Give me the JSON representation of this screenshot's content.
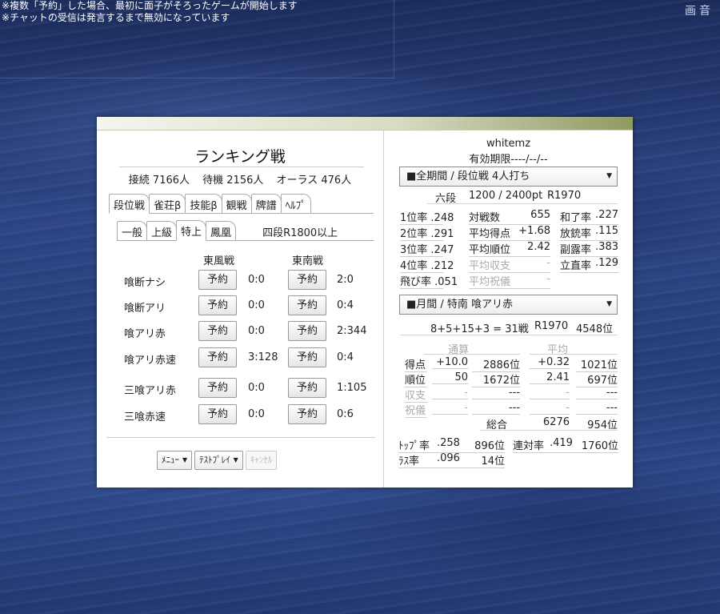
{
  "notice": {
    "line1": "※複数「予約」した場合、最初に面子がそろったゲームが開始します",
    "line2": "※チャットの受信は発言するまで無効になっています"
  },
  "corner_icons": [
    "画",
    "音"
  ],
  "lobby": {
    "title": "ランキング戦",
    "stats": {
      "connected": "接続 7166人",
      "waiting": "待機 2156人",
      "oras": "オーラス 476人"
    },
    "tabs": [
      "段位戦",
      "雀荘β",
      "技能β",
      "観戦",
      "牌譜",
      "ﾍﾙﾌﾟ"
    ],
    "subtabs": [
      "一般",
      "上級",
      "特上",
      "鳳凰"
    ],
    "condition": "四段R1800以上",
    "col_east": "東風戦",
    "col_south": "東南戦",
    "reserve_label": "予約",
    "rows": [
      {
        "name": "喰断ナシ",
        "east": "0:0",
        "south": "2:0"
      },
      {
        "name": "喰断アリ",
        "east": "0:0",
        "south": "0:4"
      },
      {
        "name": "喰アリ赤",
        "east": "0:0",
        "south": "2:344"
      },
      {
        "name": "喰アリ赤速",
        "east": "3:128",
        "south": "0:4"
      },
      {
        "name": "三喰アリ赤",
        "east": "0:0",
        "south": "1:105"
      },
      {
        "name": "三喰赤速",
        "east": "0:0",
        "south": "0:6"
      }
    ],
    "menu": "ﾒﾆｭｰ",
    "testplay": "ﾃｽﾄﾌﾟﾚｲ",
    "cancel": "ｷｬﾝｾﾙ"
  },
  "profile": {
    "username": "whitemz",
    "expiry": "有効期限----/--/--",
    "period_select": "■全期間 / 段位戦 4人打ち",
    "rank": "六段",
    "points": "1200 / 2400pt",
    "rate": "R1970",
    "stats": {
      "r1": [
        "1位率",
        ".248"
      ],
      "r2": [
        "2位率",
        ".291"
      ],
      "r3": [
        "3位率",
        ".247"
      ],
      "r4": [
        "4位率",
        ".212"
      ],
      "tobi": [
        "飛び率",
        ".051"
      ],
      "games": [
        "対戦数",
        "655"
      ],
      "avg_score": [
        "平均得点",
        "+1.68"
      ],
      "avg_rank": [
        "平均順位",
        "2.42"
      ],
      "avg_income": [
        "平均収支",
        "-"
      ],
      "avg_bonus": [
        "平均祝儀",
        "-"
      ],
      "win": [
        "和了率",
        ".227"
      ],
      "deal_in": [
        "放銃率",
        ".115"
      ],
      "call": [
        "副露率",
        ".383"
      ],
      "riichi": [
        "立直率",
        ".129"
      ]
    },
    "month_select": "■月間 / 特南 喰アリ赤",
    "month_games": "8+5+15+3 = 31戦",
    "month_rate": "R1970",
    "month_rank": "4548位",
    "col_total": "通算",
    "col_avg": "平均",
    "table": [
      {
        "label": "得点",
        "total": "+10.0",
        "total_rank": "2886位",
        "avg": "+0.32",
        "avg_rank": "1021位"
      },
      {
        "label": "順位",
        "total": "50",
        "total_rank": "1672位",
        "avg": "2.41",
        "avg_rank": "697位"
      },
      {
        "label": "収支",
        "total": "-",
        "total_rank": "---",
        "avg": "-",
        "avg_rank": "---"
      },
      {
        "label": "祝儀",
        "total": "-",
        "total_rank": "---",
        "avg": "-",
        "avg_rank": "---"
      }
    ],
    "overall_label": "総合",
    "overall_value": "6276",
    "overall_rank": "954位",
    "top_label": "ﾄｯﾌﾟ率",
    "top_value": ".258",
    "top_rank": "896位",
    "rentai_label": "連対率",
    "rentai_value": ".419",
    "rentai_rank": "1760位",
    "last_label": "ﾗｽ率",
    "last_value": ".096",
    "last_rank": "14位"
  }
}
